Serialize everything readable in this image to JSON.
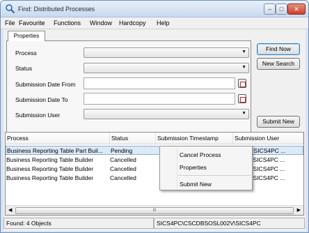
{
  "window": {
    "title": "Find: Distributed Processes"
  },
  "menu": [
    "File",
    "Favourite",
    "Functions",
    "Window",
    "Hardcopy",
    "Help"
  ],
  "tabs": {
    "active": "Properties"
  },
  "form": {
    "process_label": "Process",
    "status_label": "Status",
    "from_label": "Submission Date From",
    "to_label": "Submission Date To",
    "user_label": "Submission User"
  },
  "buttons": {
    "find_now": "Find Now",
    "new_search": "New Search",
    "submit_new": "Submit New"
  },
  "grid": {
    "columns": [
      "Process",
      "Status",
      "Submission Timestamp",
      "Submission User"
    ],
    "rows": [
      [
        "Business Reporting Table Part Buil...",
        "Pending",
        "",
        "PC, SICS4PC ..."
      ],
      [
        "Business Reporting Table Builder",
        "Cancelled",
        "",
        "PC, SICS4PC ..."
      ],
      [
        "Business Reporting Table Builder",
        "Cancelled",
        "",
        "PC, SICS4PC ..."
      ],
      [
        "Business Reporting Table Builder",
        "Cancelled",
        "",
        "PC, SICS4PC ..."
      ]
    ]
  },
  "context_menu": [
    "Cancel Process",
    "Properties",
    "Submit New"
  ],
  "status": {
    "count": "Found: 4 Objects",
    "path": "SICS4PC\\CSCDBSOSL002V\\SICS4PC"
  },
  "colors": {
    "selection": "#dce9f7",
    "title_bar": "#c9daee",
    "close_button": "#c9412b"
  }
}
